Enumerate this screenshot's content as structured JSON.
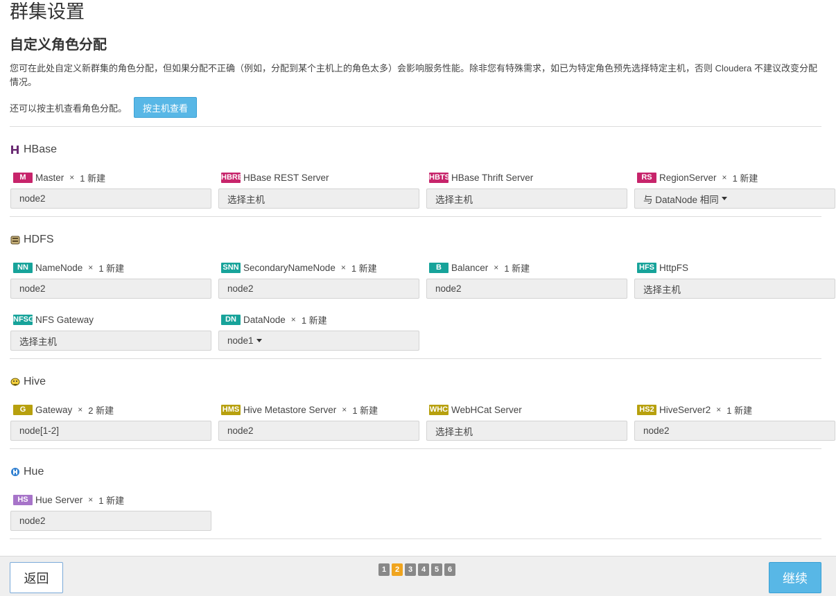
{
  "page": {
    "title": "群集设置",
    "section_title": "自定义角色分配",
    "description": "您可在此处自定义新群集的角色分配，但如果分配不正确（例如，分配到某个主机上的角色太多）会影响服务性能。除非您有特殊需求，如已为特定角色预先选择特定主机，否则 Cloudera 不建议改变分配情况。",
    "view_by_host_text": "还可以按主机查看角色分配。",
    "view_by_host_button": "按主机查看"
  },
  "services": {
    "hbase": {
      "name": "HBase",
      "roles": [
        {
          "badge": "M",
          "name": "Master",
          "times": "×",
          "new": "1 新建",
          "host": "node2"
        },
        {
          "badge": "HBRE",
          "name": "HBase REST Server",
          "times": "",
          "new": "",
          "host": "选择主机"
        },
        {
          "badge": "HBTS",
          "name": "HBase Thrift Server",
          "times": "",
          "new": "",
          "host": "选择主机"
        },
        {
          "badge": "RS",
          "name": "RegionServer",
          "times": "×",
          "new": "1 新建",
          "host": "与 DataNode 相同"
        }
      ]
    },
    "hdfs": {
      "name": "HDFS",
      "roles": [
        {
          "badge": "NN",
          "name": "NameNode",
          "times": "×",
          "new": "1 新建",
          "host": "node2"
        },
        {
          "badge": "SNN",
          "name": "SecondaryNameNode",
          "times": "×",
          "new": "1 新建",
          "host": "node2"
        },
        {
          "badge": "B",
          "name": "Balancer",
          "times": "×",
          "new": "1 新建",
          "host": "node2"
        },
        {
          "badge": "HFS",
          "name": "HttpFS",
          "times": "",
          "new": "",
          "host": "选择主机"
        },
        {
          "badge": "NFSG",
          "name": "NFS Gateway",
          "times": "",
          "new": "",
          "host": "选择主机"
        },
        {
          "badge": "DN",
          "name": "DataNode",
          "times": "×",
          "new": "1 新建",
          "host": "node1"
        }
      ]
    },
    "hive": {
      "name": "Hive",
      "roles": [
        {
          "badge": "G",
          "name": "Gateway",
          "times": "×",
          "new": "2 新建",
          "host": "node[1-2]"
        },
        {
          "badge": "HMS",
          "name": "Hive Metastore Server",
          "times": "×",
          "new": "1 新建",
          "host": "node2"
        },
        {
          "badge": "WHC",
          "name": "WebHCat Server",
          "times": "",
          "new": "",
          "host": "选择主机"
        },
        {
          "badge": "HS2",
          "name": "HiveServer2",
          "times": "×",
          "new": "1 新建",
          "host": "node2"
        }
      ]
    },
    "hue": {
      "name": "Hue",
      "roles": [
        {
          "badge": "HS",
          "name": "Hue Server",
          "times": "×",
          "new": "1 新建",
          "host": "node2"
        }
      ]
    }
  },
  "footer": {
    "back_label": "返回",
    "continue_label": "继续",
    "steps": [
      "1",
      "2",
      "3",
      "4",
      "5",
      "6"
    ],
    "active_step": "2"
  },
  "colors": {
    "primary_button": "#58b7e6",
    "hbase_badge": "#c7246b",
    "hdfs_badge": "#17a39a",
    "hive_badge": "#b7a00e",
    "hue_badge": "#a774c9",
    "active_step": "#f0a51f"
  }
}
